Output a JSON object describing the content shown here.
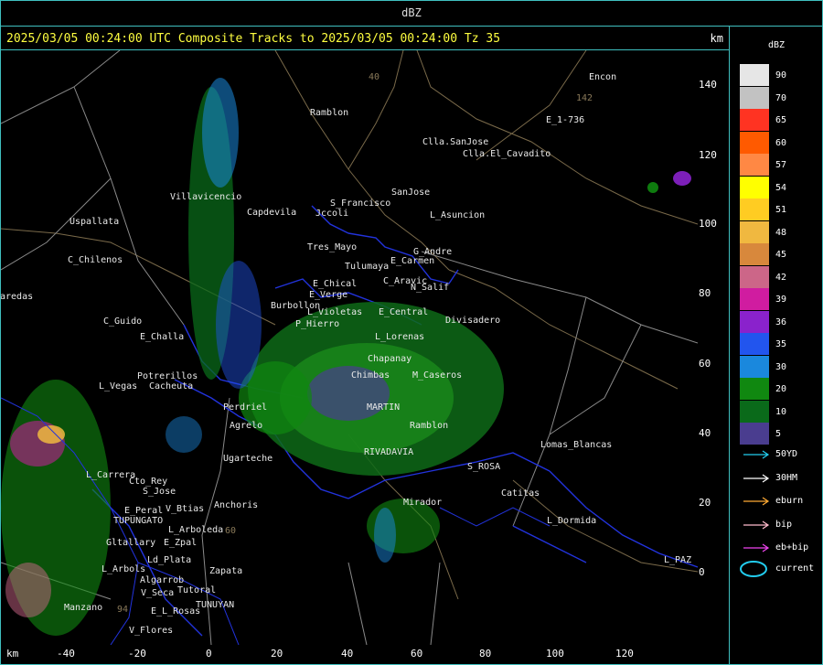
{
  "window_title": "dBZ",
  "header": {
    "text": "2025/03/05 00:24:00 UTC Composite Tracks to 2025/03/05 00:24:00 Tz 35",
    "km_label": "km"
  },
  "axes": {
    "x_unit": "km",
    "x_ticks": [
      "-40",
      "-20",
      "0",
      "20",
      "40",
      "60",
      "80",
      "100",
      "120"
    ],
    "y_ticks": [
      "140",
      "120",
      "100",
      "80",
      "60",
      "40",
      "20",
      "0"
    ]
  },
  "legend": {
    "title": "dBZ",
    "levels": [
      {
        "value": "90",
        "color": "#e6e6e6"
      },
      {
        "value": "70",
        "color": "#c2c2c2"
      },
      {
        "value": "65",
        "color": "#ff3322"
      },
      {
        "value": "60",
        "color": "#ff5a00"
      },
      {
        "value": "57",
        "color": "#ff8844"
      },
      {
        "value": "54",
        "color": "#ffff00"
      },
      {
        "value": "51",
        "color": "#ffcc22"
      },
      {
        "value": "48",
        "color": "#f0b840"
      },
      {
        "value": "45",
        "color": "#d8883c"
      },
      {
        "value": "42",
        "color": "#cc6688"
      },
      {
        "value": "39",
        "color": "#d01ca0"
      },
      {
        "value": "36",
        "color": "#8a22cc"
      },
      {
        "value": "35",
        "color": "#2255ee"
      },
      {
        "value": "30",
        "color": "#1a88dd"
      },
      {
        "value": "20",
        "color": "#108810"
      },
      {
        "value": "10",
        "color": "#0a6a1a"
      },
      {
        "value": "5",
        "color": "#4a3d8f"
      }
    ],
    "tracks": [
      {
        "label": "50YD",
        "color": "#22ccee"
      },
      {
        "label": "30HM",
        "color": "#ffffff"
      },
      {
        "label": "eburn",
        "color": "#ffaa33"
      },
      {
        "label": "bip",
        "color": "#ffbbcc"
      },
      {
        "label": "eb+bip",
        "color": "#ee44ee"
      }
    ],
    "current": {
      "label": "current",
      "color": "#22ccee"
    }
  },
  "places": [
    {
      "name": "Encon"
    },
    {
      "name": "Ramblon"
    },
    {
      "name": "E_1-736"
    },
    {
      "name": "Clla.SanJose"
    },
    {
      "name": "Clla.El_Cavadito"
    },
    {
      "name": "S_Francisco"
    },
    {
      "name": "SanJose"
    },
    {
      "name": "Jccoli"
    },
    {
      "name": "L_Asuncion"
    },
    {
      "name": "Uspallata"
    },
    {
      "name": "Villavicencio"
    },
    {
      "name": "Capdevila"
    },
    {
      "name": "Tres_Mayo"
    },
    {
      "name": "G_Andre"
    },
    {
      "name": "Tulumaya"
    },
    {
      "name": "E_Carmen"
    },
    {
      "name": "C_Chilenos"
    },
    {
      "name": "E_Chical"
    },
    {
      "name": "C_Aravic"
    },
    {
      "name": "E_Verge"
    },
    {
      "name": "N_Salif"
    },
    {
      "name": "aredas"
    },
    {
      "name": "Burbollon"
    },
    {
      "name": "E_Central"
    },
    {
      "name": "C_Guido"
    },
    {
      "name": "L_Violetas"
    },
    {
      "name": "P_Hierro"
    },
    {
      "name": "Divisadero"
    },
    {
      "name": "E_Challa"
    },
    {
      "name": "L_Lorenas"
    },
    {
      "name": "Chapanay"
    },
    {
      "name": "L_Vegas"
    },
    {
      "name": "Potrerillos"
    },
    {
      "name": "Cacheuta"
    },
    {
      "name": "Chimbas"
    },
    {
      "name": "M_Caseros"
    },
    {
      "name": "Perdriel"
    },
    {
      "name": "MARTIN"
    },
    {
      "name": "Agrelo"
    },
    {
      "name": "Ramblon"
    },
    {
      "name": "Lomas_Blancas"
    },
    {
      "name": "Ugarteche"
    },
    {
      "name": "RIVADAVIA"
    },
    {
      "name": "L_Carrera"
    },
    {
      "name": "Cto_Rey"
    },
    {
      "name": "S_ROSA"
    },
    {
      "name": "S_Jose"
    },
    {
      "name": "Catitas"
    },
    {
      "name": "E_Peral"
    },
    {
      "name": "V_Btias"
    },
    {
      "name": "Anchoris"
    },
    {
      "name": "Mirador"
    },
    {
      "name": "TUPUNGATO"
    },
    {
      "name": "L_Arboleda"
    },
    {
      "name": "L_Dormida"
    },
    {
      "name": "Gltallary"
    },
    {
      "name": "E_Zpal"
    },
    {
      "name": "Ld_Plata"
    },
    {
      "name": "Zapata"
    },
    {
      "name": "L_PAZ"
    },
    {
      "name": "L_Arbols"
    },
    {
      "name": "Algarrob"
    },
    {
      "name": "V_Seca"
    },
    {
      "name": "Tutoral"
    },
    {
      "name": "Manzano"
    },
    {
      "name": "E_L_Rosas"
    },
    {
      "name": "TUNUYAN"
    },
    {
      "name": "V_Flores"
    },
    {
      "name": "142"
    },
    {
      "name": "40"
    },
    {
      "name": "94"
    },
    {
      "name": "60"
    }
  ]
}
